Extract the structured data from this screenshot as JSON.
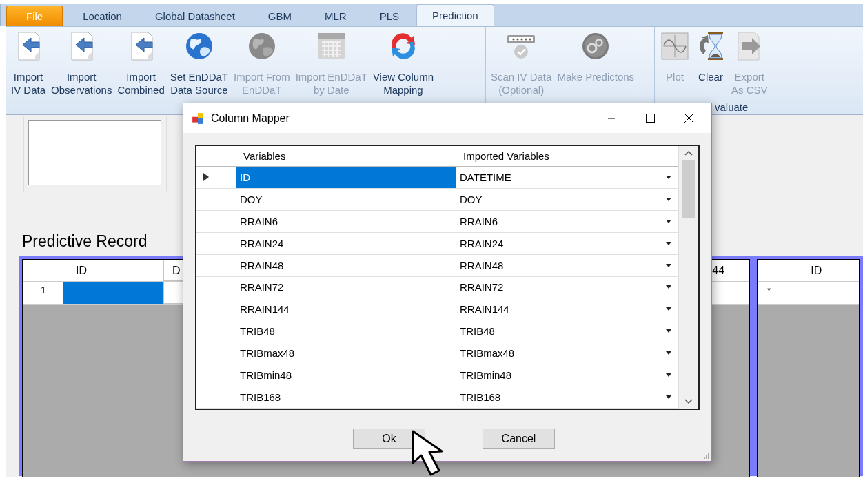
{
  "tabs": [
    {
      "label": "File",
      "kind": "file",
      "selected": false
    },
    {
      "label": "Location",
      "kind": "tab",
      "selected": false
    },
    {
      "label": "Global Datasheet",
      "kind": "tab",
      "selected": false
    },
    {
      "label": "GBM",
      "kind": "tab",
      "selected": false
    },
    {
      "label": "MLR",
      "kind": "tab",
      "selected": false
    },
    {
      "label": "PLS",
      "kind": "tab",
      "selected": false
    },
    {
      "label": "Prediction",
      "kind": "tab",
      "selected": true
    }
  ],
  "ribbon": {
    "groups": [
      {
        "buttons": [
          {
            "label": "Import\nIV Data",
            "kind": "import",
            "disabled": false
          },
          {
            "label": "Import\nObservations",
            "kind": "import",
            "disabled": false
          },
          {
            "label": "Import\nCombined",
            "kind": "import",
            "disabled": false
          },
          {
            "label": "Set EnDDaT\nData Source",
            "kind": "globe",
            "disabled": false
          },
          {
            "label": "Import From\nEnDDaT",
            "kind": "globe",
            "disabled": true
          },
          {
            "label": "Import EnDDaT\nby Date",
            "kind": "calendar",
            "disabled": true
          },
          {
            "label": "View Column\nMapping",
            "kind": "sync",
            "disabled": false
          }
        ]
      },
      {
        "buttons": [
          {
            "label": "Scan IV Data\n(Optional)",
            "kind": "scan",
            "disabled": true
          },
          {
            "label": "Make Predictons",
            "kind": "gears",
            "disabled": true
          }
        ]
      },
      {
        "label": "valuate",
        "buttons": [
          {
            "label": "Plot",
            "kind": "plot",
            "disabled": true
          },
          {
            "label": "Clear",
            "kind": "hourglass",
            "disabled": false
          },
          {
            "label": "Export\nAs CSV",
            "kind": "export",
            "disabled": true
          }
        ]
      }
    ]
  },
  "main": {
    "section_title": "Predictive Record",
    "grid": {
      "columns": [
        "ID",
        "D",
        "44"
      ],
      "rows": [
        {
          "header": "1",
          "cells": [
            {
              "selected": true
            },
            {
              "selected": false
            },
            {
              "selected": false
            }
          ]
        }
      ]
    },
    "side_grid": {
      "columns": [
        "ID"
      ],
      "rows": [
        {
          "header": "*"
        }
      ]
    }
  },
  "dialog": {
    "title": "Column Mapper",
    "columns": [
      "Variables",
      "Imported Variables"
    ],
    "rows": [
      {
        "variable": "ID",
        "imported": "DATETIME",
        "selected": true
      },
      {
        "variable": "DOY",
        "imported": "DOY",
        "selected": false
      },
      {
        "variable": "RRAIN6",
        "imported": "RRAIN6",
        "selected": false
      },
      {
        "variable": "RRAIN24",
        "imported": "RRAIN24",
        "selected": false
      },
      {
        "variable": "RRAIN48",
        "imported": "RRAIN48",
        "selected": false
      },
      {
        "variable": "RRAIN72",
        "imported": "RRAIN72",
        "selected": false
      },
      {
        "variable": "RRAIN144",
        "imported": "RRAIN144",
        "selected": false
      },
      {
        "variable": "TRIB48",
        "imported": "TRIB48",
        "selected": false
      },
      {
        "variable": "TRIBmax48",
        "imported": "TRIBmax48",
        "selected": false
      },
      {
        "variable": "TRIBmin48",
        "imported": "TRIBmin48",
        "selected": false
      },
      {
        "variable": "TRIB168",
        "imported": "TRIB168",
        "selected": false
      }
    ],
    "buttons": [
      "Ok",
      "Cancel"
    ]
  }
}
